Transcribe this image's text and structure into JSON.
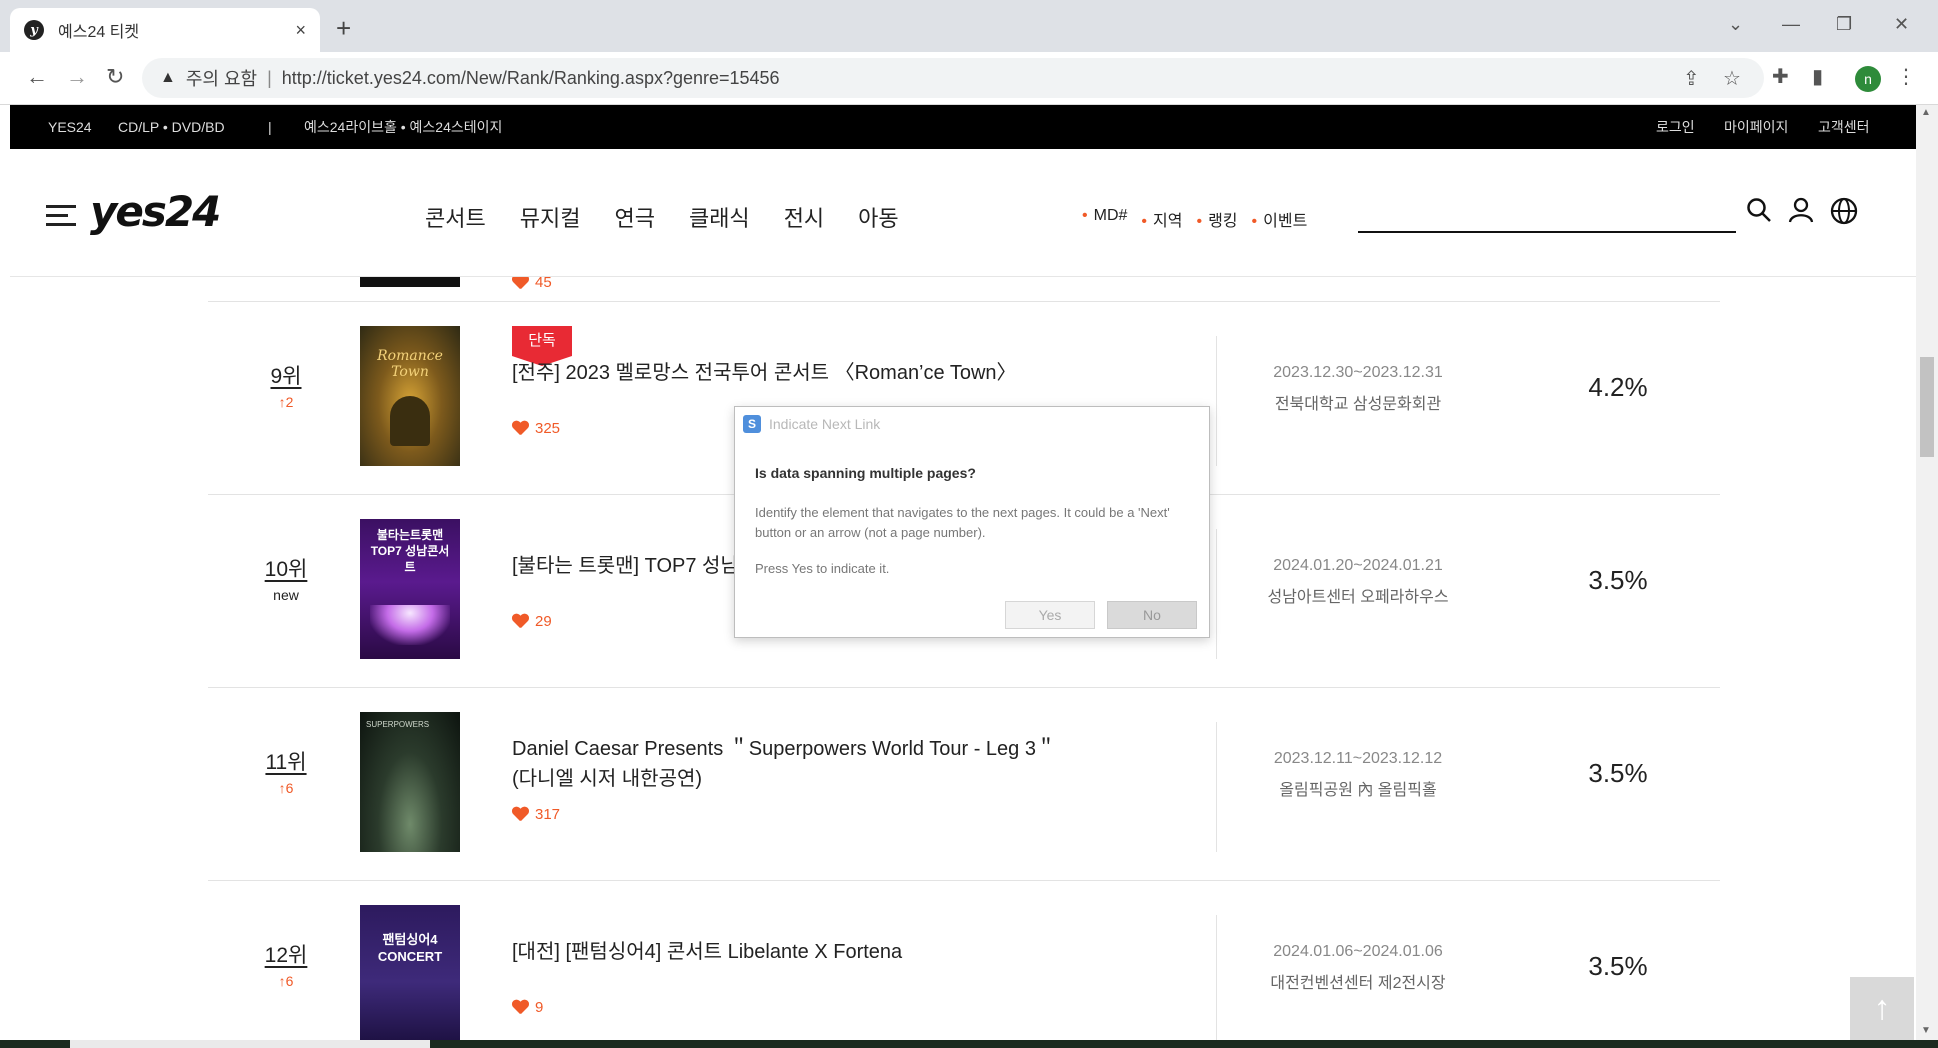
{
  "browser": {
    "tab_title": "예스24 티켓",
    "favicon_letter": "y",
    "tab_close": "×",
    "new_tab": "+",
    "security_label": "주의 요함",
    "separator": "|",
    "url": "http://ticket.yes24.com/New/Rank/Ranking.aspx?genre=15456",
    "profile_initial": "n"
  },
  "topbar": {
    "links_left": [
      "YES24",
      "CD/LP • DVD/BD",
      "|",
      "예스24라이브홀 • 예스24스테이지"
    ],
    "links_right": [
      "로그인",
      "마이페이지",
      "고객센터"
    ]
  },
  "header": {
    "logo": "yes24",
    "genres": [
      "콘서트",
      "뮤지컬",
      "연극",
      "클래식",
      "전시",
      "아동"
    ],
    "sub_menu": [
      "MD#",
      "지역",
      "랭킹",
      "이벤트"
    ],
    "search_value": ""
  },
  "partial_prev_likes": "45",
  "rank_items": [
    {
      "rank": "9위",
      "change": "↑2",
      "badge": "단독",
      "title_line1": "[전주] 2023 멜로망스 전국투어 콘서트 〈Roman’ce Town〉",
      "title_line2": "",
      "likes": "325",
      "dates": "2023.12.30~2023.12.31",
      "venue": "전북대학교 삼성문화회관",
      "share": "4.2%",
      "poster_text": "Romance Town"
    },
    {
      "rank": "10위",
      "change": "new",
      "badge": "",
      "title_line1": "[불타는 트롯맨] TOP7 성남 콘서트",
      "title_line2": "",
      "likes": "29",
      "dates": "2024.01.20~2024.01.21",
      "venue": "성남아트센터 오페라하우스",
      "share": "3.5%",
      "poster_text": "불타는트롯맨 TOP7 성남콘서트"
    },
    {
      "rank": "11위",
      "change": "↑6",
      "badge": "",
      "title_line1": "Daniel Caesar Presents ＂Superpowers World Tour - Leg 3＂",
      "title_line2": "(다니엘 시저 내한공연)",
      "likes": "317",
      "dates": "2023.12.11~2023.12.12",
      "venue": "올림픽공원 內 올림픽홀",
      "share": "3.5%",
      "poster_text": "SUPERPOWERS"
    },
    {
      "rank": "12위",
      "change": "↑6",
      "badge": "",
      "title_line1": "[대전] [팬텀싱어4] 콘서트 Libelante X Fortena",
      "title_line2": "",
      "likes": "9",
      "dates": "2024.01.06~2024.01.06",
      "venue": "대전컨벤션센터 제2전시장",
      "share": "3.5%",
      "poster_text": "팬텀싱어4 CONCERT"
    }
  ],
  "dialog": {
    "app_icon": "S",
    "title": "Indicate Next Link",
    "question": "Is data spanning multiple pages?",
    "description": "Identify the element that navigates to the next pages. It could be a 'Next' button or an arrow (not a page number).",
    "hint": "Press Yes to indicate it.",
    "yes_label": "Yes",
    "no_label": "No"
  },
  "top_button": "↑",
  "colors": {
    "accent_orange": "#f05a28",
    "badge_red": "#e82a34",
    "topbar_black": "#000000"
  }
}
